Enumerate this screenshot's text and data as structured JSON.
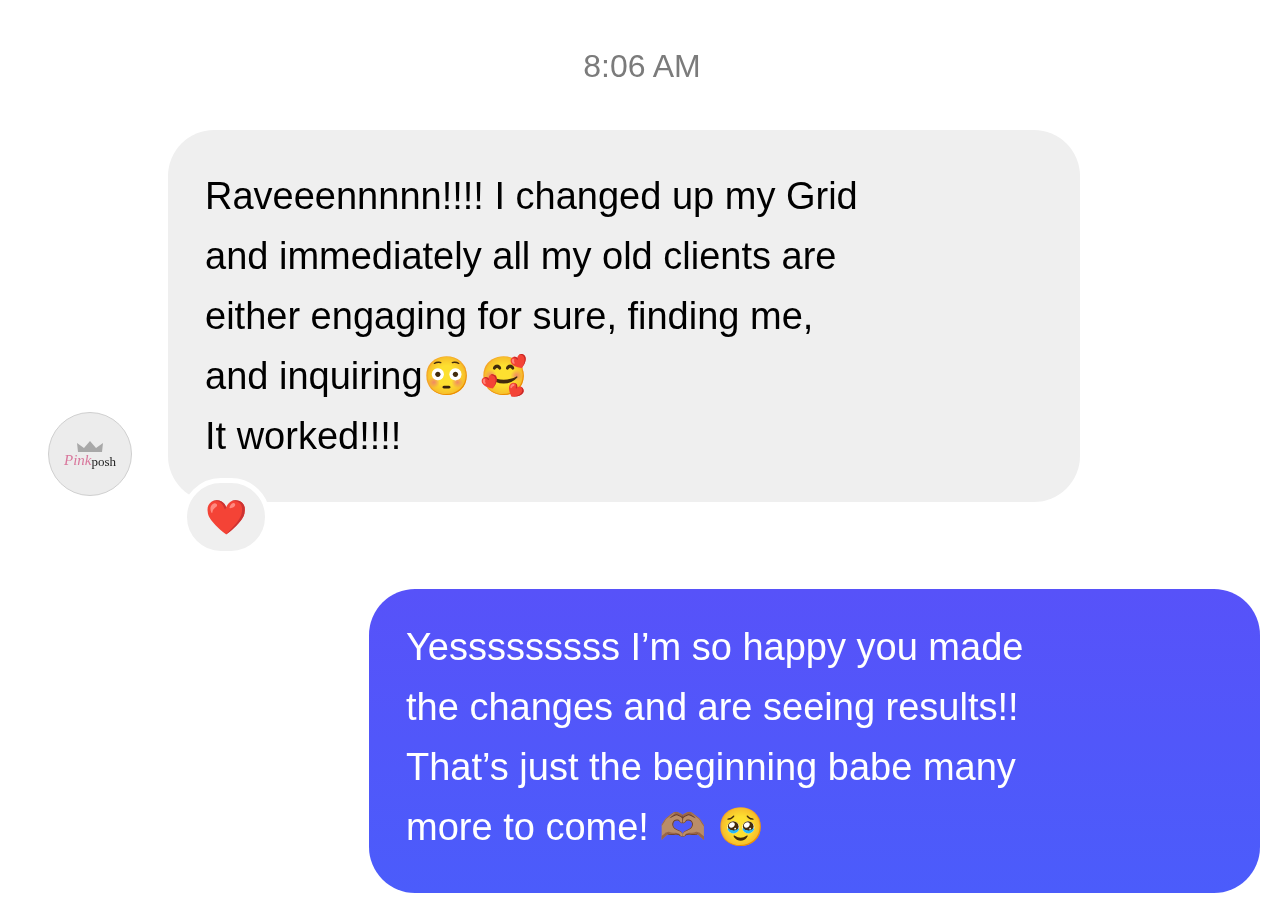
{
  "timestamp": "8:06 AM",
  "messages": [
    {
      "kind": "incoming",
      "lines": [
        "Raveeennnnn!!!! I changed up my Grid",
        "and immediately all my old clients are",
        "either engaging for sure, finding me,",
        "and inquiring😳 🥰",
        "It worked!!!!"
      ],
      "avatar": {
        "script": "Pink",
        "word": "posh"
      },
      "reaction": "❤️"
    },
    {
      "kind": "outgoing",
      "lines": [
        "Yesssssssss I’m so happy you made",
        "the changes and are seeing results!!",
        "That’s just the beginning babe many",
        "more to come! 🫶🏽 🥹"
      ]
    }
  ]
}
